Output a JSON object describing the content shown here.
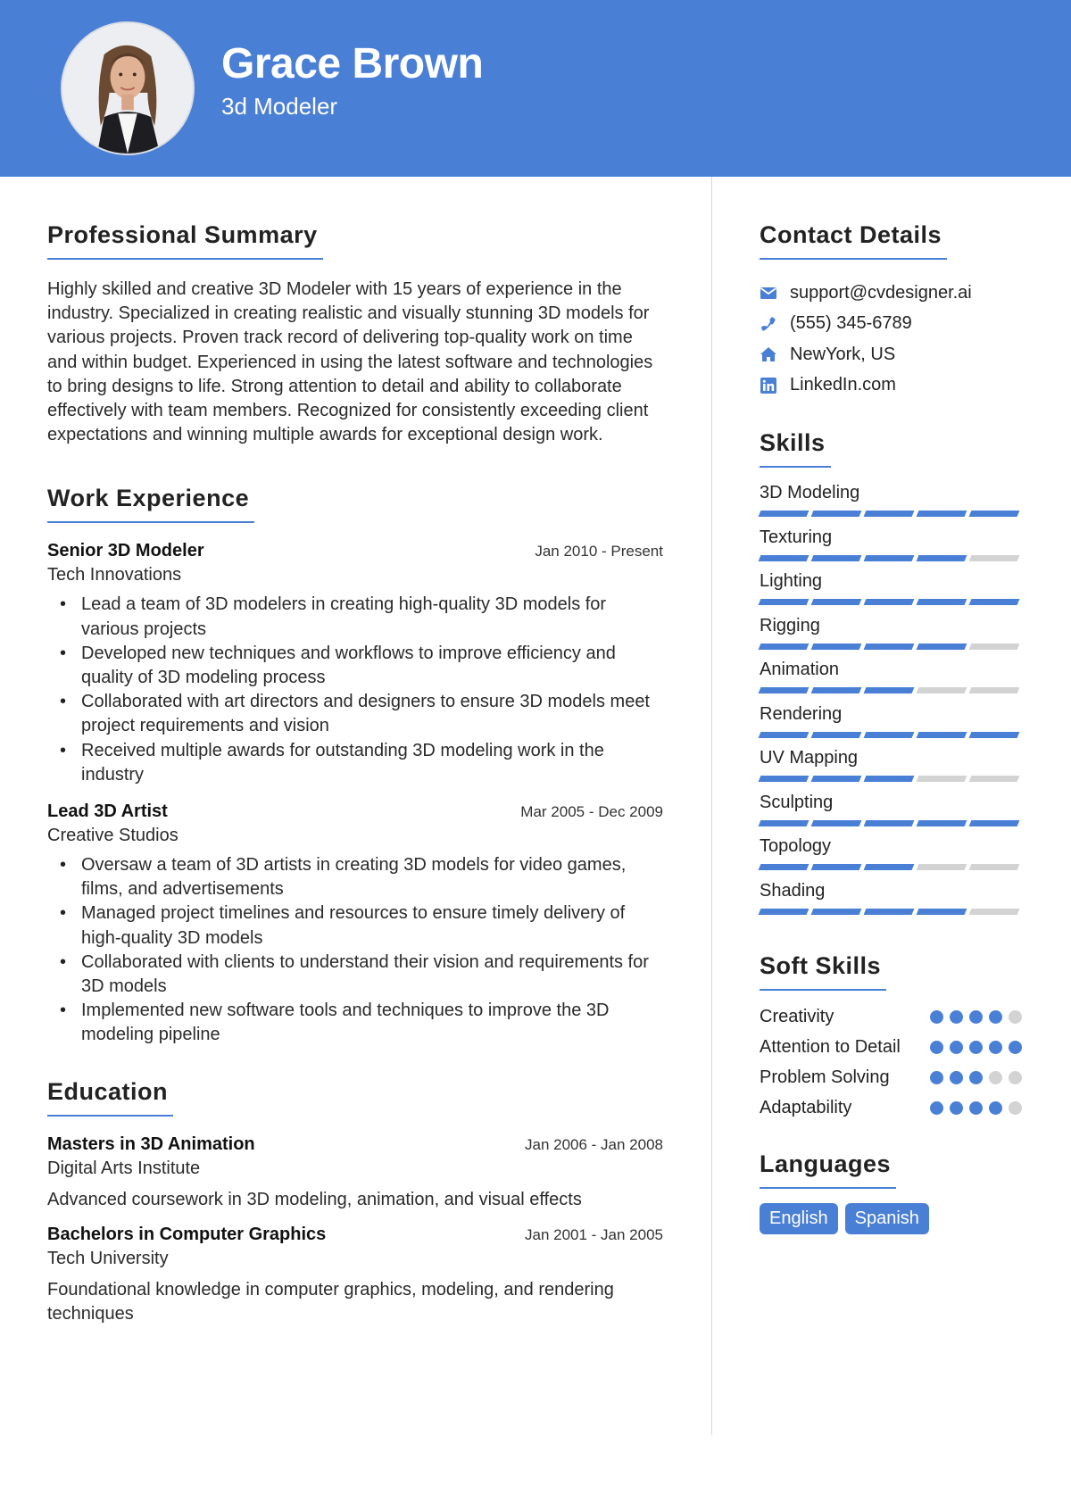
{
  "header": {
    "name": "Grace Brown",
    "title": "3d Modeler",
    "photo_alt": "profile-photo"
  },
  "colors": {
    "accent": "#4a7fd6",
    "inactive": "#d3d3d3",
    "text": "#222222"
  },
  "summary": {
    "heading": "Professional Summary",
    "text": "Highly skilled and creative 3D Modeler with 15 years of experience in the industry. Specialized in creating realistic and visually stunning 3D models for various projects. Proven track record of delivering top-quality work on time and within budget. Experienced in using the latest software and technologies to bring designs to life. Strong attention to detail and ability to collaborate effectively with team members. Recognized for consistently exceeding client expectations and winning multiple awards for exceptional design work."
  },
  "work": {
    "heading": "Work Experience",
    "jobs": [
      {
        "title": "Senior 3D Modeler",
        "company": "Tech Innovations",
        "dates": "Jan 2010 - Present",
        "bullets": [
          "Lead a team of 3D modelers in creating high-quality 3D models for various projects",
          "Developed new techniques and workflows to improve efficiency and quality of 3D modeling process",
          "Collaborated with art directors and designers to ensure 3D models meet project requirements and vision",
          "Received multiple awards for outstanding 3D modeling work in the industry"
        ]
      },
      {
        "title": "Lead 3D Artist",
        "company": "Creative Studios",
        "dates": "Mar 2005 - Dec 2009",
        "bullets": [
          "Oversaw a team of 3D artists in creating 3D models for video games, films, and advertisements",
          "Managed project timelines and resources to ensure timely delivery of high-quality 3D models",
          "Collaborated with clients to understand their vision and requirements for 3D models",
          "Implemented new software tools and techniques to improve the 3D modeling pipeline"
        ]
      }
    ]
  },
  "education": {
    "heading": "Education",
    "items": [
      {
        "degree": "Masters in 3D Animation",
        "school": "Digital Arts Institute",
        "dates": "Jan 2006 - Jan 2008",
        "description": "Advanced coursework in 3D modeling, animation, and visual effects"
      },
      {
        "degree": "Bachelors in Computer Graphics",
        "school": "Tech University",
        "dates": "Jan 2001 - Jan 2005",
        "description": "Foundational knowledge in computer graphics, modeling, and rendering techniques"
      }
    ]
  },
  "contact": {
    "heading": "Contact Details",
    "items": [
      {
        "icon": "envelope-icon",
        "text": "support@cvdesigner.ai"
      },
      {
        "icon": "phone-icon",
        "text": "(555) 345-6789"
      },
      {
        "icon": "home-icon",
        "text": "NewYork, US"
      },
      {
        "icon": "linkedin-icon",
        "text": "LinkedIn.com"
      }
    ]
  },
  "skills": {
    "heading": "Skills",
    "max": 5,
    "items": [
      {
        "name": "3D Modeling",
        "level": 5
      },
      {
        "name": "Texturing",
        "level": 4
      },
      {
        "name": "Lighting",
        "level": 5
      },
      {
        "name": "Rigging",
        "level": 4
      },
      {
        "name": "Animation",
        "level": 3
      },
      {
        "name": "Rendering",
        "level": 5
      },
      {
        "name": "UV Mapping",
        "level": 3
      },
      {
        "name": "Sculpting",
        "level": 5
      },
      {
        "name": "Topology",
        "level": 3
      },
      {
        "name": "Shading",
        "level": 4
      }
    ]
  },
  "soft_skills": {
    "heading": "Soft Skills",
    "max": 5,
    "items": [
      {
        "name": "Creativity",
        "level": 4
      },
      {
        "name": "Attention to Detail",
        "level": 5
      },
      {
        "name": "Problem Solving",
        "level": 3
      },
      {
        "name": "Adaptability",
        "level": 4
      }
    ]
  },
  "languages": {
    "heading": "Languages",
    "items": [
      "English",
      "Spanish"
    ]
  }
}
